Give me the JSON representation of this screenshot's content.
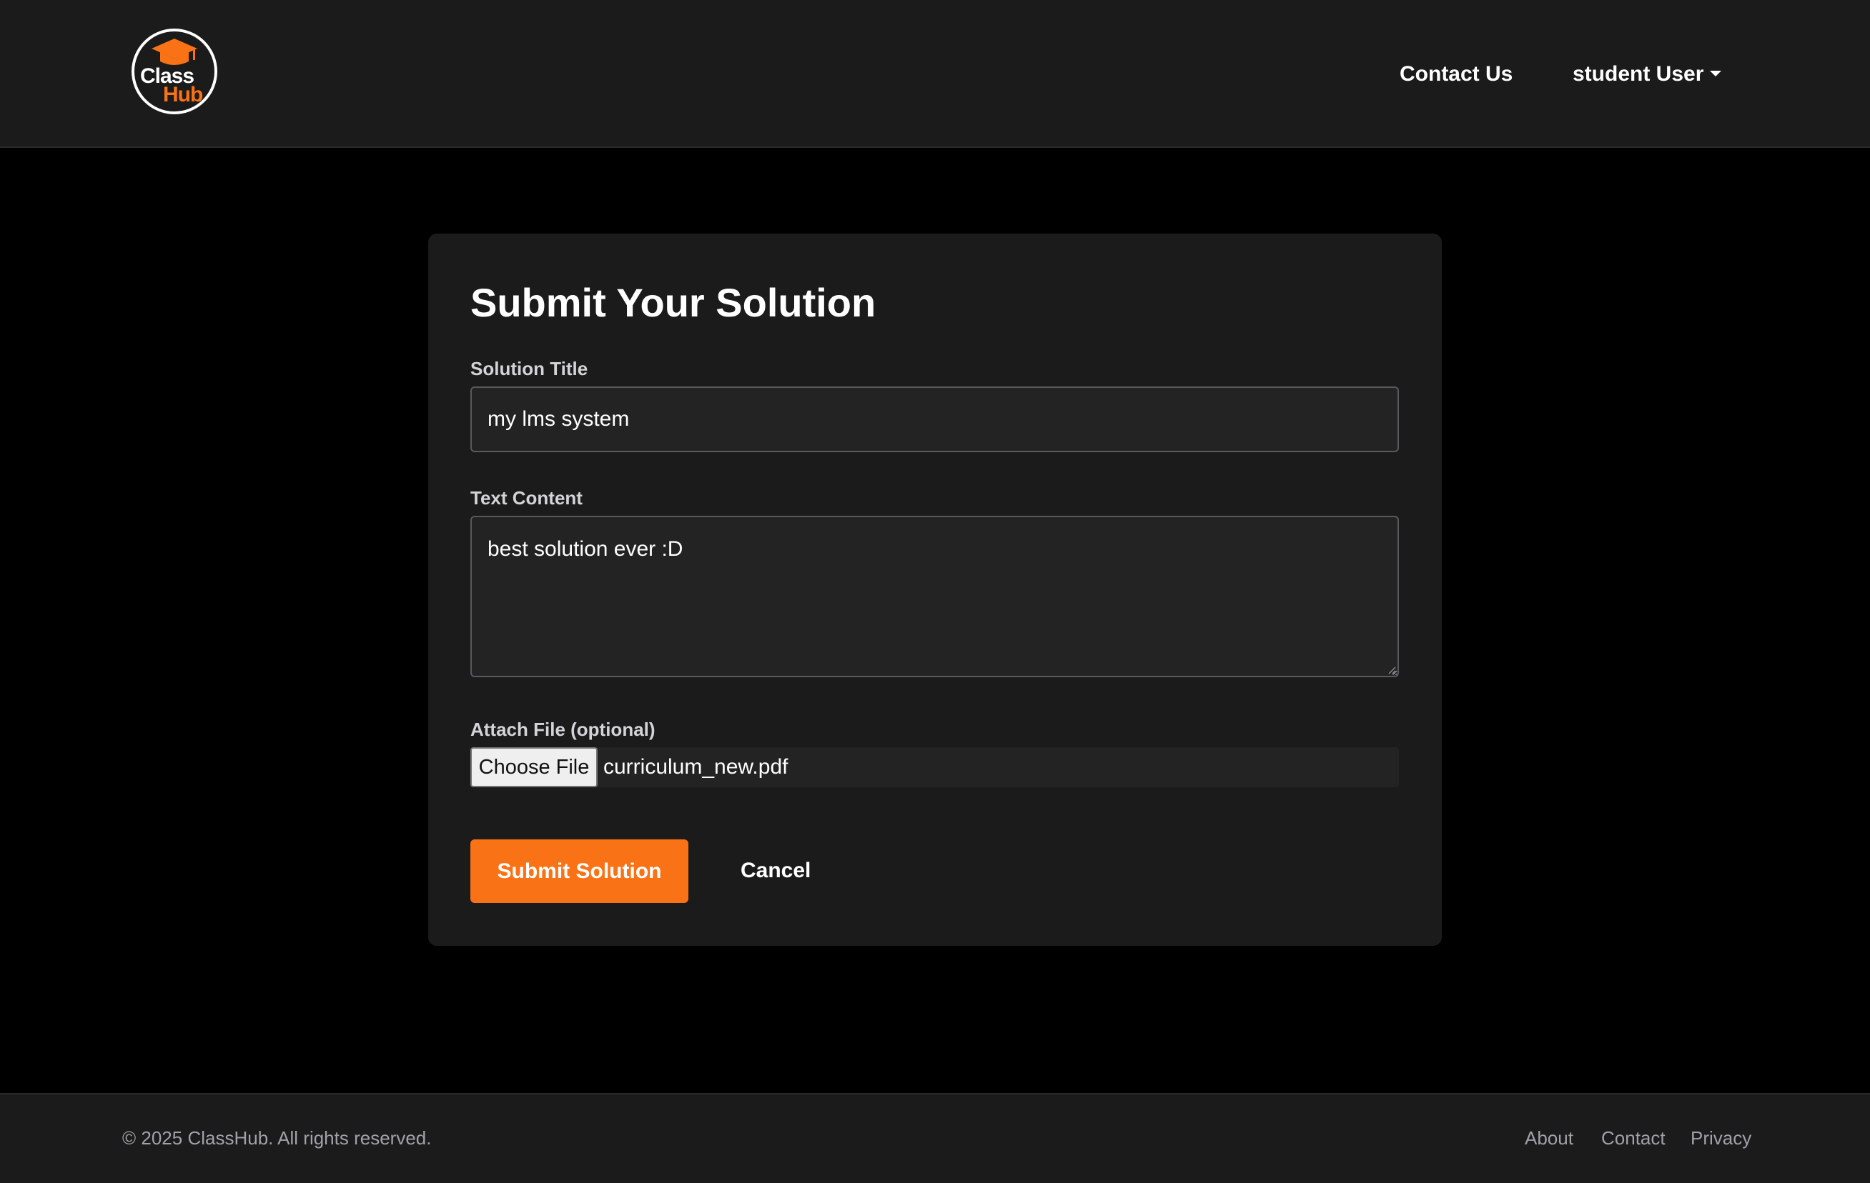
{
  "brand": {
    "logo_line1": "Class",
    "logo_line2": "Hub",
    "accent_color": "#f97316"
  },
  "header": {
    "nav": {
      "contact_label": "Contact Us",
      "user_label": "student User"
    },
    "icons": {
      "logo": "graduation-cap-icon",
      "dropdown": "caret-down-icon"
    }
  },
  "form": {
    "title": "Submit Your Solution",
    "solution_title": {
      "label": "Solution Title",
      "value": "my lms system"
    },
    "text_content": {
      "label": "Text Content",
      "value": "best solution ever :D"
    },
    "attach_file": {
      "label": "Attach File (optional)",
      "button_label": "Choose File",
      "file_name": "curriculum_new.pdf"
    },
    "submit_label": "Submit Solution",
    "cancel_label": "Cancel"
  },
  "footer": {
    "copyright": "© 2025 ClassHub. All rights reserved.",
    "links": {
      "about": "About",
      "contact": "Contact",
      "privacy": "Privacy"
    }
  }
}
